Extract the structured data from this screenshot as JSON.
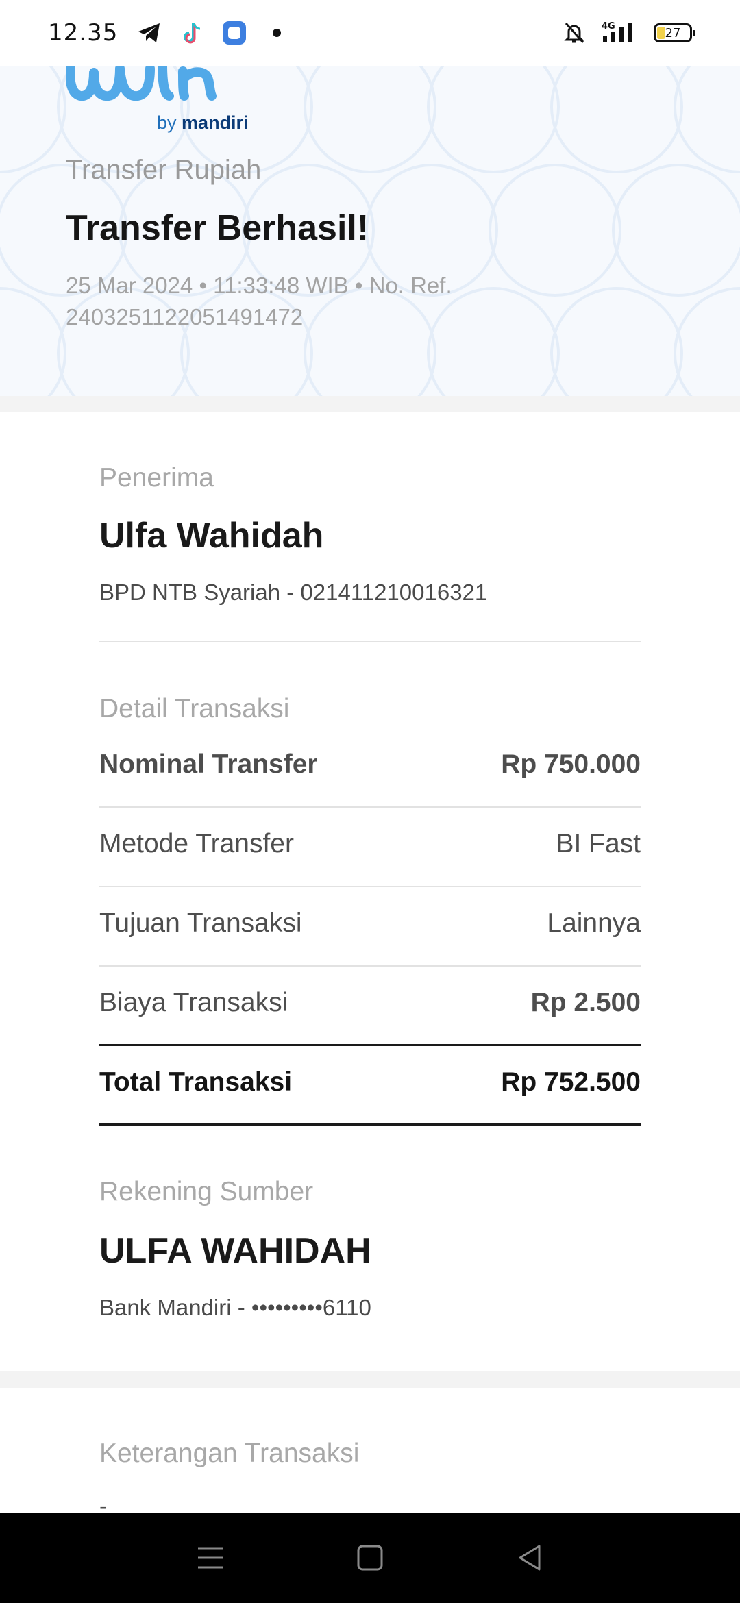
{
  "status_bar": {
    "time": "12.35",
    "network": "4G",
    "battery_level": "27",
    "icons": [
      "telegram-icon",
      "tiktok-icon",
      "app-icon",
      "dot-icon",
      "bell-off-icon",
      "signal-icon",
      "battery-icon"
    ]
  },
  "brand": {
    "by": "by",
    "name": "mandiri",
    "colors": {
      "logo": "#4fa8e6",
      "by": "#1f6fba",
      "mandiri": "#0b3b78"
    }
  },
  "header": {
    "subtitle": "Transfer Rupiah",
    "title": "Transfer Berhasil!",
    "meta": "25 Mar 2024 • 11:33:48 WIB • No. Ref. 2403251122051491472"
  },
  "recipient": {
    "label": "Penerima",
    "name": "Ulfa Wahidah",
    "bank_account": "BPD NTB Syariah - 021411210016321"
  },
  "details": {
    "label": "Detail Transaksi",
    "rows": [
      {
        "label": "Nominal Transfer",
        "value": "Rp 750.000"
      },
      {
        "label": "Metode Transfer",
        "value": "BI Fast"
      },
      {
        "label": "Tujuan Transaksi",
        "value": "Lainnya"
      },
      {
        "label": "Biaya Transaksi",
        "value": "Rp 2.500"
      }
    ],
    "total": {
      "label": "Total Transaksi",
      "value": "Rp 752.500"
    }
  },
  "source": {
    "label": "Rekening Sumber",
    "name": "ULFA WAHIDAH",
    "bank_account": "Bank Mandiri - •••••••••6110"
  },
  "notes": {
    "label": "Keterangan Transaksi",
    "value": "-"
  },
  "nav": {
    "icons": [
      "menu-icon",
      "home-square-icon",
      "back-triangle-icon"
    ]
  }
}
